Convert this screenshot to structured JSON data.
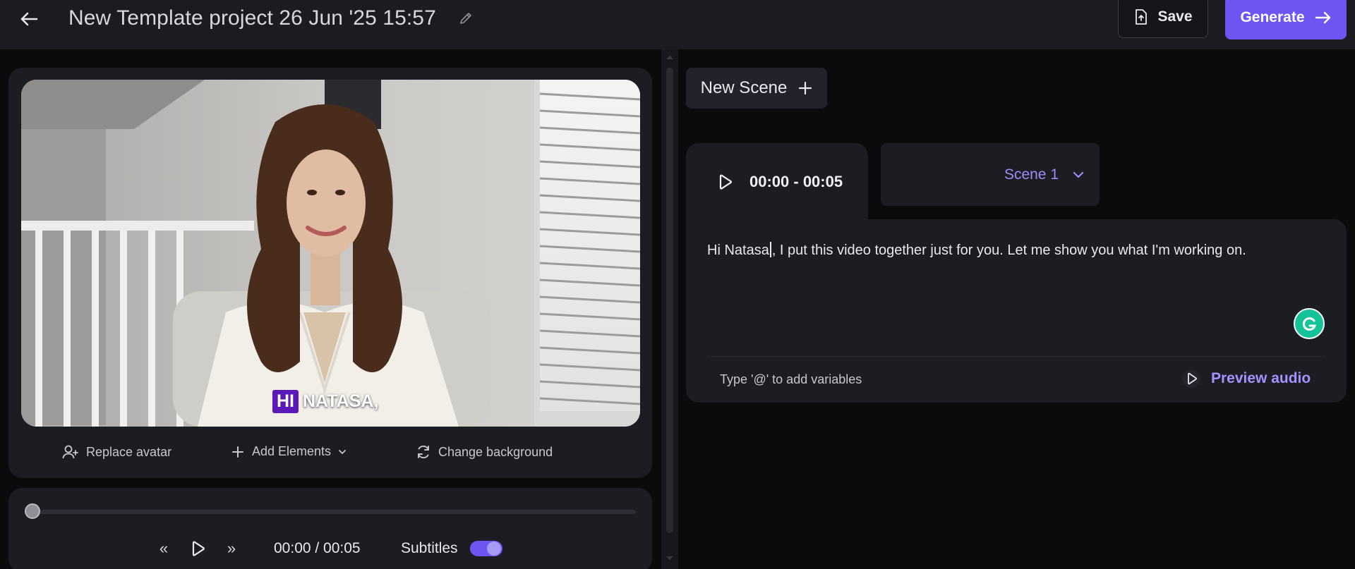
{
  "header": {
    "project_title": "New Template project 26 Jun '25 15:57",
    "save_label": "Save",
    "generate_label": "Generate"
  },
  "preview": {
    "subtitle_highlight": "HI",
    "subtitle_rest": "NATASA,",
    "actions": {
      "replace_avatar": "Replace avatar",
      "add_elements": "Add Elements",
      "change_background": "Change background"
    }
  },
  "player": {
    "time_readout": "00:00 / 00:05",
    "subtitles_label": "Subtitles",
    "subtitles_enabled": true,
    "progress": 0,
    "rewind_glyph": "«",
    "forward_glyph": "»"
  },
  "scenes": {
    "new_scene_label": "New Scene",
    "active_scene_time": "00:00 - 00:05",
    "selected_scene": "Scene 1",
    "script_before_caret": "Hi Natasa",
    "script_after_caret": ", I put this video together just for you. Let me show you what I'm working on.",
    "variables_hint": "Type '@' to add variables",
    "preview_audio_label": "Preview audio"
  },
  "colors": {
    "accent": "#6d55f2",
    "accent_text": "#a493ff",
    "subtitle_highlight": "#5b19b8",
    "panel": "#1c1d23",
    "background": "#0b0b0e"
  },
  "icons": [
    "back-arrow-icon",
    "pencil-icon",
    "upload-file-icon",
    "arrow-right-icon",
    "user-plus-icon",
    "plus-icon",
    "chevron-down-icon",
    "refresh-icon",
    "rewind-icon",
    "play-icon",
    "forward-icon",
    "grammarly-icon"
  ]
}
